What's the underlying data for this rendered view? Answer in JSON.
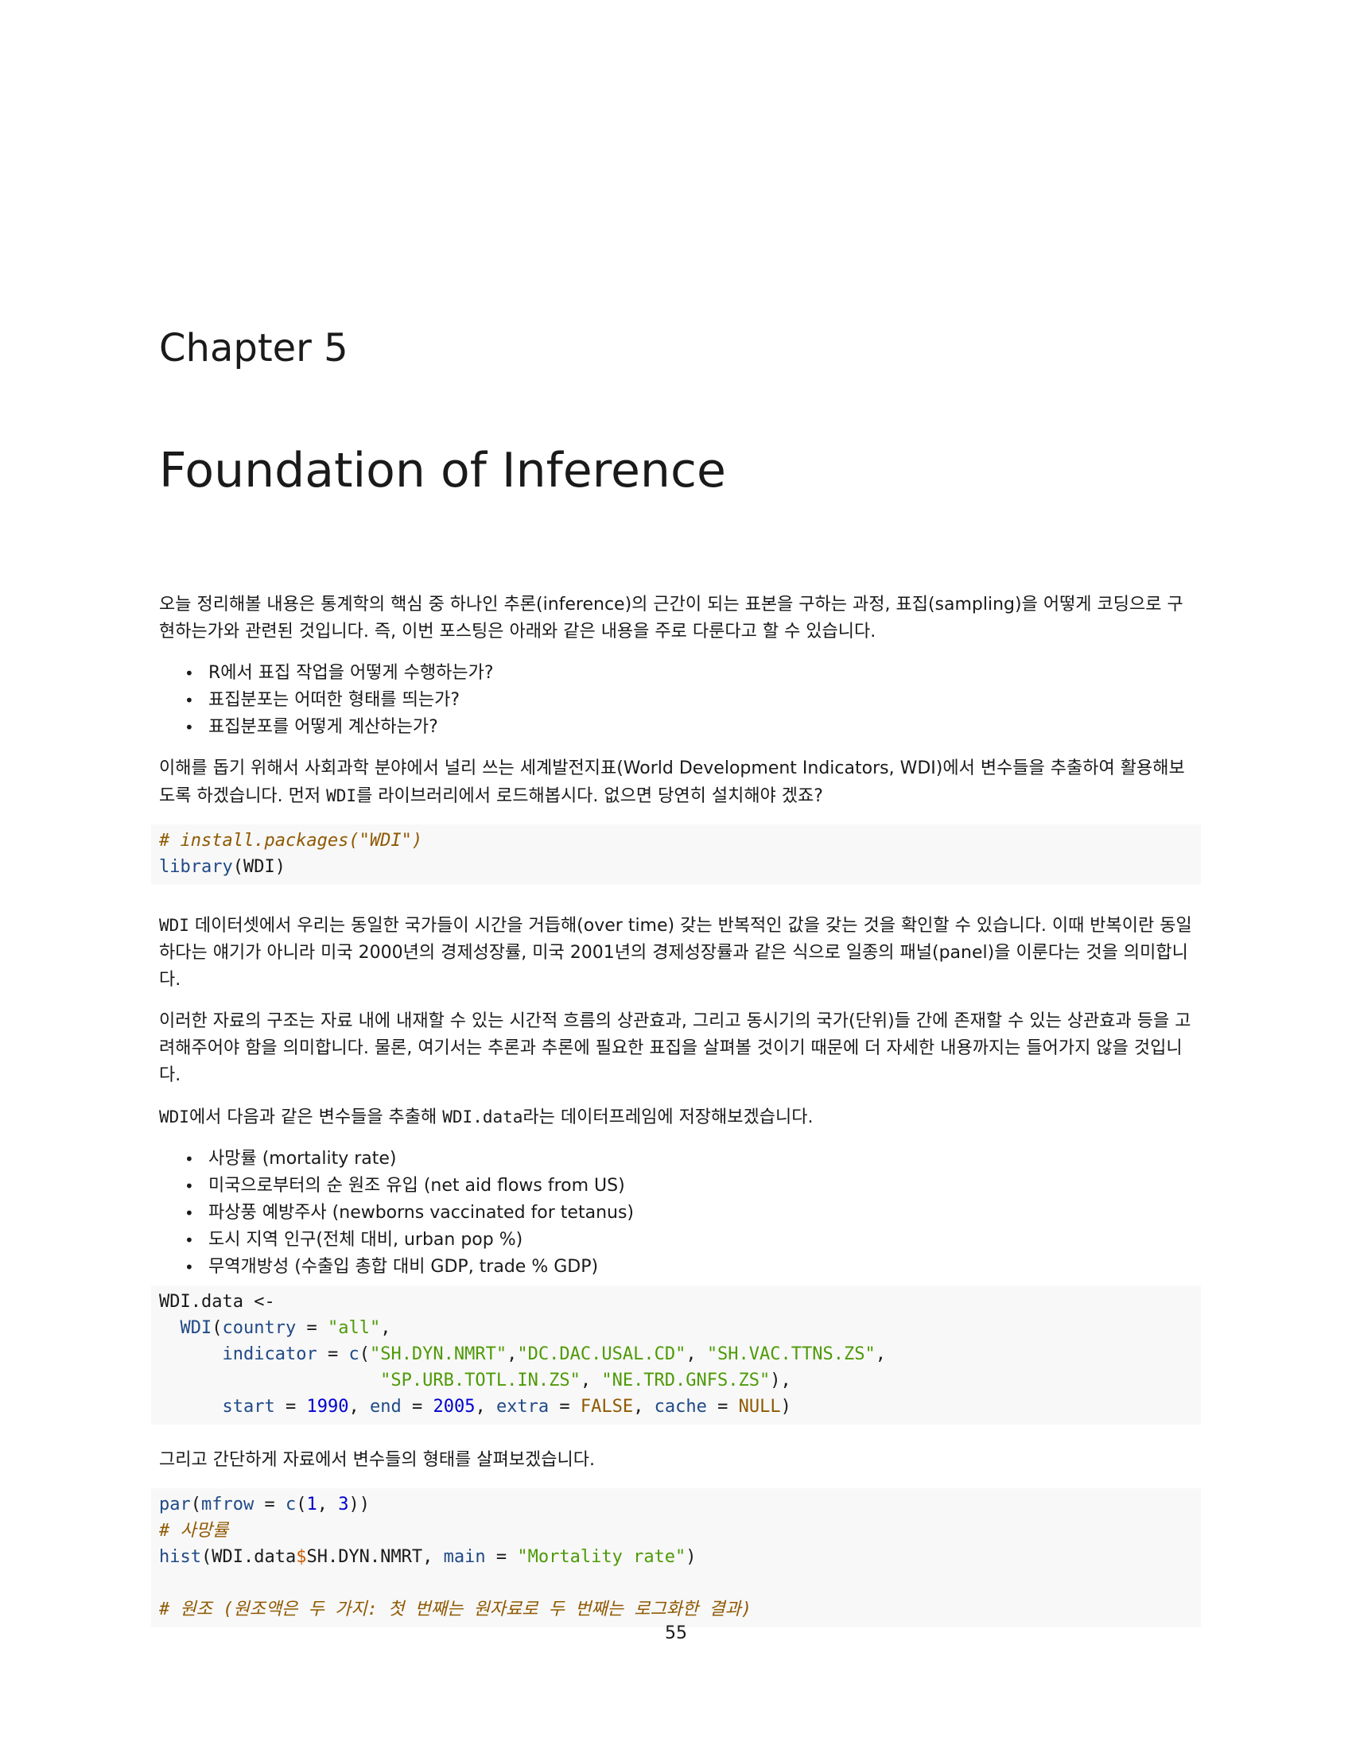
{
  "chapter": {
    "label": "Chapter 5",
    "title": "Foundation of Inference"
  },
  "paragraphs": {
    "intro": "오늘 정리해볼 내용은 통계학의 핵심 중 하나인 추론(inference)의 근간이 되는 표본을 구하는 과정, 표집(sampling)을 어떻게 코딩으로 구현하는가와 관련된 것입니다. 즉, 이번 포스팅은 아래와 같은 내용을 주로 다룬다고 할 수 있습니다.",
    "wdi_a": "이해를 돕기 위해서 사회과학 분야에서 널리 쓰는 세계발전지표(World Development Indicators, WDI)에서 변수들을 추출하여 활용해보도록 하겠습니다. 먼저 ",
    "wdi_code": "WDI",
    "wdi_b": "를 라이브러리에서 로드해봅시다. 없으면 당연히 설치해야 겠죠?",
    "dataset_code": "WDI",
    "dataset_text": " 데이터셋에서 우리는 동일한 국가들이 시간을 거듭해(over time) 갖는 반복적인 값을 갖는 것을 확인할 수 있습니다. 이때 반복이란 동일하다는 얘기가 아니라 미국 2000년의 경제성장률, 미국 2001년의 경제성장률과 같은 식으로 일종의 패널(panel)을 이룬다는 것을 의미합니다.",
    "structure": "이러한 자료의 구조는 자료 내에 내재할 수 있는 시간적 흐름의 상관효과, 그리고 동시기의 국가(단위)들 간에 존재할 수 있는 상관효과 등을 고려해주어야 함을 의미합니다. 물론, 여기서는 추론과 추론에 필요한 표집을 살펴볼 것이기 때문에 더 자세한 내용까지는 들어가지 않을 것입니다.",
    "extract_code1": "WDI",
    "extract_text1": "에서 다음과 같은 변수들을 추출해 ",
    "extract_code2": "WDI.data",
    "extract_text2": "라는 데이터프레임에 저장해보겠습니다.",
    "simple": "그리고 간단하게 자료에서 변수들의 형태를 살펴보겠습니다."
  },
  "bullets1": [
    "R에서 표집 작업을 어떻게 수행하는가?",
    "표집분포는 어떠한 형태를 띄는가?",
    "표집분포를 어떻게 계산하는가?"
  ],
  "bullets2": [
    "사망률 (mortality rate)",
    "미국으로부터의 순 원조 유입 (net aid flows from US)",
    "파상풍 예방주사 (newborns vaccinated for tetanus)",
    "도시 지역 인구(전체 대비, urban pop %)",
    "무역개방성 (수출입 총합 대비 GDP, trade % GDP)"
  ],
  "code1": {
    "comment": "# install.packages(\"WDI\")",
    "library_fn": "library",
    "library_arg": "(WDI)"
  },
  "code2": {
    "l1": "WDI.data <-",
    "l2_indent": "  ",
    "l2_fn": "WDI",
    "l2_a": "(",
    "l2_kw": "country",
    "l2_eq": " = ",
    "l2_str": "\"all\"",
    "l2_end": ",",
    "l3_indent": "      ",
    "l3_kw": "indicator",
    "l3_eq": " = ",
    "l3_fn": "c",
    "l3_p": "(",
    "l3_s1": "\"SH.DYN.NMRT\"",
    "l3_c1": ",",
    "l3_s2": "\"DC.DAC.USAL.CD\"",
    "l3_c2": ", ",
    "l3_s3": "\"SH.VAC.TTNS.ZS\"",
    "l3_c3": ",",
    "l4_indent": "                     ",
    "l4_s1": "\"SP.URB.TOTL.IN.ZS\"",
    "l4_c1": ", ",
    "l4_s2": "\"NE.TRD.GNFS.ZS\"",
    "l4_end": "),",
    "l5_indent": "      ",
    "l5_kw1": "start",
    "l5_eq1": " = ",
    "l5_n1": "1990",
    "l5_c1": ", ",
    "l5_kw2": "end",
    "l5_eq2": " = ",
    "l5_n2": "2005",
    "l5_c2": ", ",
    "l5_kw3": "extra",
    "l5_eq3": " = ",
    "l5_v3": "FALSE",
    "l5_c3": ", ",
    "l5_kw4": "cache",
    "l5_eq4": " = ",
    "l5_v4": "NULL",
    "l5_end": ")"
  },
  "code3": {
    "l1_fn": "par",
    "l1_a": "(",
    "l1_kw": "mfrow",
    "l1_eq": " = ",
    "l1_fn2": "c",
    "l1_b": "(",
    "l1_n1": "1",
    "l1_c": ", ",
    "l1_n2": "3",
    "l1_end": "))",
    "l2_comment": "# 사망률",
    "l3_fn": "hist",
    "l3_a": "(WDI.data",
    "l3_op": "$",
    "l3_b": "SH.DYN.NMRT, ",
    "l3_kw": "main",
    "l3_eq": " = ",
    "l3_str": "\"Mortality rate\"",
    "l3_end": ")",
    "l5_comment": "# 원조 (원조액은 두 가지: 첫 번째는 원자료로 두 번째는 로그화한 결과)"
  },
  "page_number": "55"
}
